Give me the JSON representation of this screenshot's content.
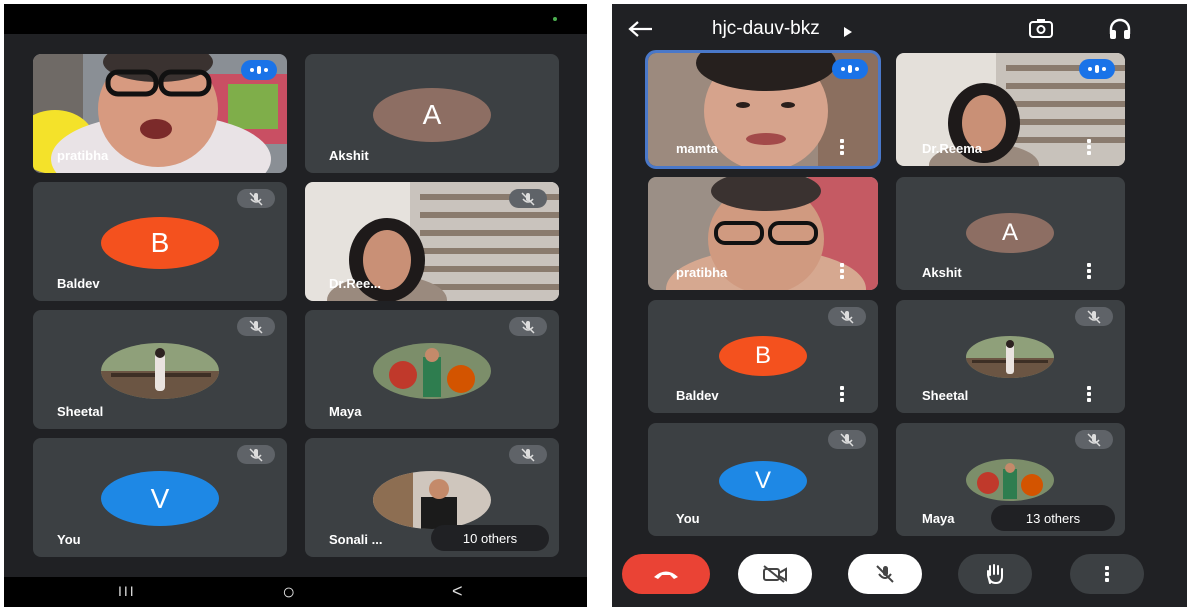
{
  "left_screen": {
    "tiles": [
      {
        "name": "pratibha"
      },
      {
        "name": "Akshit",
        "initial": "A",
        "color": "#8d6e63"
      },
      {
        "name": "Baldev",
        "initial": "B",
        "color": "#f4511e"
      },
      {
        "name": "Dr.Ree..."
      },
      {
        "name": "Sheetal"
      },
      {
        "name": "Maya"
      },
      {
        "name": "You",
        "initial": "V",
        "color": "#1e88e5"
      },
      {
        "name": "Sonali ..."
      }
    ],
    "others_label": "10 others",
    "nav": {
      "recents": "III",
      "home": "○",
      "back": "<"
    }
  },
  "right_screen": {
    "meeting_code": "hjc-dauv-bkz",
    "tiles": [
      {
        "name": "mamta"
      },
      {
        "name": "Dr.Reema"
      },
      {
        "name": "pratibha"
      },
      {
        "name": "Akshit",
        "initial": "A",
        "color": "#8d6e63"
      },
      {
        "name": "Baldev",
        "initial": "B",
        "color": "#f4511e"
      },
      {
        "name": "Sheetal"
      },
      {
        "name": "You",
        "initial": "V",
        "color": "#1e88e5"
      },
      {
        "name": "Maya"
      }
    ],
    "others_label": "13 others",
    "controls": {
      "end_call_color": "#ea4335"
    }
  }
}
